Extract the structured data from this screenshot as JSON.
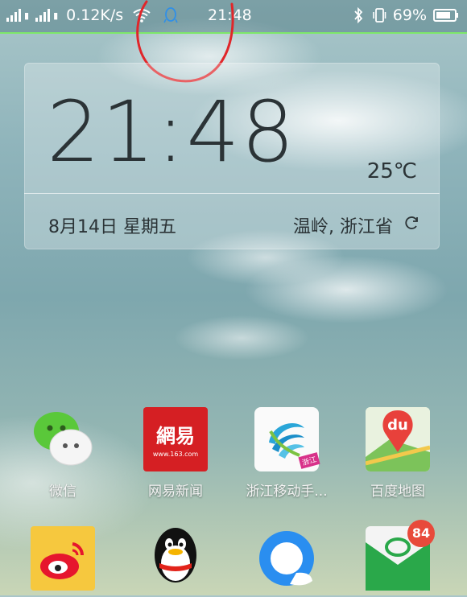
{
  "status_bar": {
    "network_speed": "0.12K/s",
    "time": "21:48",
    "battery_percent": "69%",
    "icons": [
      "signal-icon",
      "signal-icon",
      "wifi-icon",
      "qq-icon",
      "bluetooth-icon",
      "vibrate-icon",
      "battery-icon"
    ]
  },
  "widget": {
    "clock": "21:48",
    "temperature": "25℃",
    "date": "8月14日 星期五",
    "location": "温岭, 浙江省"
  },
  "apps_row1": [
    {
      "label": "微信",
      "icon": "wechat-icon"
    },
    {
      "label": "网易新闻",
      "icon": "netease-news-icon",
      "icon_text": "網易",
      "icon_subtext": "www.163.com"
    },
    {
      "label": "浙江移动手...",
      "icon": "china-mobile-icon",
      "icon_text": "浙江"
    },
    {
      "label": "百度地图",
      "icon": "baidu-map-icon",
      "icon_text": "du"
    }
  ],
  "apps_row2": [
    {
      "icon": "weibo-icon"
    },
    {
      "icon": "qq-penguin-icon"
    },
    {
      "icon": "qq-browser-icon"
    },
    {
      "icon": "wandoujia-icon",
      "badge": "84"
    }
  ],
  "colors": {
    "statusbar_line": "#7ee86a",
    "annotation": "#e0262a",
    "badge": "#e84a3b"
  }
}
